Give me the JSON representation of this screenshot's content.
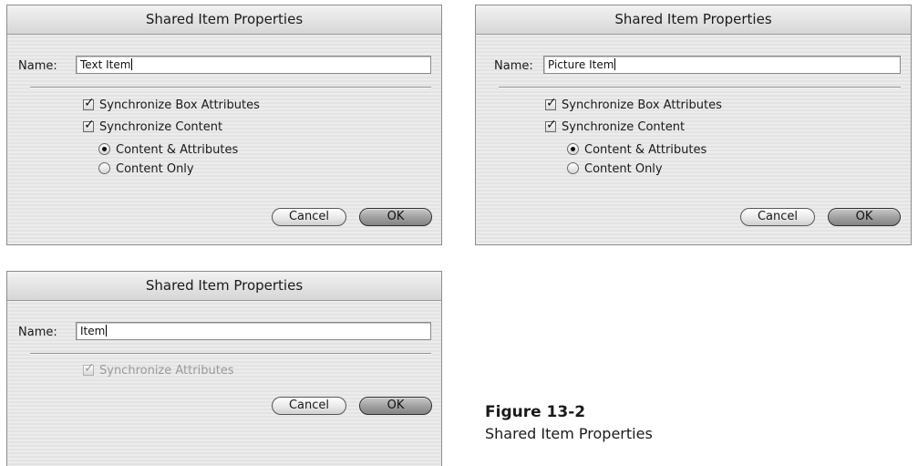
{
  "dialogs": [
    {
      "title": "Shared Item Properties",
      "name_label": "Name:",
      "name_value": "Text Item",
      "checkboxes": [
        {
          "label": "Synchronize Box Attributes",
          "checked": true
        },
        {
          "label": "Synchronize Content",
          "checked": true
        }
      ],
      "radios": [
        {
          "label": "Content & Attributes",
          "selected": true
        },
        {
          "label": "Content Only",
          "selected": false
        }
      ],
      "cancel_label": "Cancel",
      "ok_label": "OK"
    },
    {
      "title": "Shared Item Properties",
      "name_label": "Name:",
      "name_value": "Picture Item",
      "checkboxes": [
        {
          "label": "Synchronize Box Attributes",
          "checked": true
        },
        {
          "label": "Synchronize Content",
          "checked": true
        }
      ],
      "radios": [
        {
          "label": "Content & Attributes",
          "selected": true
        },
        {
          "label": "Content Only",
          "selected": false
        }
      ],
      "cancel_label": "Cancel",
      "ok_label": "OK"
    },
    {
      "title": "Shared Item Properties",
      "name_label": "Name:",
      "name_value": "Item",
      "checkboxes": [
        {
          "label": "Synchronize Attributes",
          "checked": true,
          "disabled": true
        }
      ],
      "cancel_label": "Cancel",
      "ok_label": "OK"
    }
  ],
  "caption": {
    "figure_number": "Figure 13-2",
    "figure_title": "Shared Item Properties"
  },
  "icons": {
    "checkbox_mark": "✓"
  }
}
